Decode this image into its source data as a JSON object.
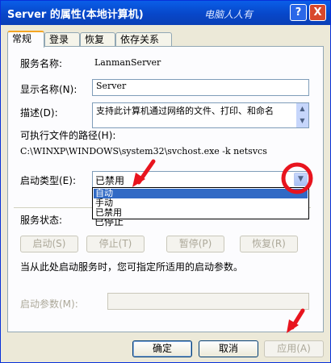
{
  "window": {
    "title": "Server 的属性(本地计算机)",
    "watermark": "电脑人人有",
    "help_label": "?",
    "close_label": "X"
  },
  "tabs": [
    {
      "label": "常规",
      "active": true
    },
    {
      "label": "登录",
      "active": false
    },
    {
      "label": "恢复",
      "active": false
    },
    {
      "label": "依存关系",
      "active": false
    }
  ],
  "general": {
    "service_name_label": "服务名称:",
    "service_name_value": "LanmanServer",
    "display_name_label": "显示名称(N):",
    "display_name_value": "Server",
    "description_label": "描述(D):",
    "description_value": "支持此计算机通过网络的文件、打印、和命名",
    "path_label": "可执行文件的路径(H):",
    "path_value": "C:\\WINXP\\WINDOWS\\system32\\svchost.exe -k netsvcs",
    "startup_type_label": "启动类型(E):",
    "startup_type_value": "已禁用",
    "startup_options": [
      "自动",
      "手动",
      "已禁用"
    ],
    "highlighted_option": "自动",
    "status_label": "服务状态:",
    "status_value": "已停止",
    "start_button": "启动(S)",
    "stop_button": "停止(T)",
    "pause_button": "暂停(P)",
    "resume_button": "恢复(R)",
    "hint_text": "当从此处启动服务时，您可指定所适用的启动参数。",
    "params_label": "启动参数(M):",
    "params_value": ""
  },
  "footer": {
    "ok_button": "确定",
    "cancel_button": "取消",
    "apply_button": "应用(A)"
  },
  "annotation_colors": {
    "arrow": "#e8141e",
    "circle": "#e8141e"
  }
}
